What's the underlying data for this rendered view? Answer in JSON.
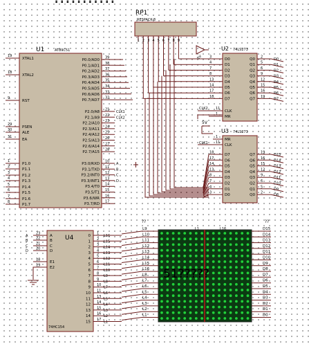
{
  "title": "???????????",
  "rp1": {
    "ref": "RP1",
    "part": "RESPACK-8",
    "pins": [
      "1",
      "2",
      "3",
      "4",
      "5",
      "6",
      "7",
      "8",
      "9"
    ]
  },
  "u1": {
    "ref": "U1",
    "part": "AT89C51",
    "left_pins": [
      {
        "num": "19",
        "name": "XTAL1"
      },
      {
        "num": "18",
        "name": "XTAL2"
      },
      {
        "num": "9",
        "name": "RST"
      },
      {
        "num": "29",
        "name": "PSEN"
      },
      {
        "num": "30",
        "name": "ALE"
      },
      {
        "num": "31",
        "name": "EA"
      },
      {
        "num": "1",
        "name": "P1.0"
      },
      {
        "num": "2",
        "name": "P1.1"
      },
      {
        "num": "3",
        "name": "P1.2"
      },
      {
        "num": "4",
        "name": "P1.3"
      },
      {
        "num": "5",
        "name": "P1.4"
      },
      {
        "num": "6",
        "name": "P1.5"
      },
      {
        "num": "7",
        "name": "P1.6"
      },
      {
        "num": "8",
        "name": "P1.7"
      }
    ],
    "p0": [
      {
        "name": "P0.0/AD0",
        "num": "39"
      },
      {
        "name": "P0.1/AD1",
        "num": "38"
      },
      {
        "name": "P0.2/AD2",
        "num": "37"
      },
      {
        "name": "P0.3/AD3",
        "num": "36"
      },
      {
        "name": "P0.4/AD4",
        "num": "35"
      },
      {
        "name": "P0.5/AD5",
        "num": "34"
      },
      {
        "name": "P0.6/AD6",
        "num": "33"
      },
      {
        "name": "P0.7/AD7",
        "num": "32"
      }
    ],
    "p2": [
      {
        "name": "P2.0/A8",
        "num": "21",
        "net": "CLK1"
      },
      {
        "name": "P2.1/A9",
        "num": "22",
        "net": "CLK2"
      },
      {
        "name": "P2.2/A10",
        "num": "23",
        "net": ""
      },
      {
        "name": "P2.3/A11",
        "num": "24",
        "net": ""
      },
      {
        "name": "P2.4/A12",
        "num": "25",
        "net": ""
      },
      {
        "name": "P2.5/A13",
        "num": "26",
        "net": ""
      },
      {
        "name": "P2.6/A14",
        "num": "27",
        "net": ""
      },
      {
        "name": "P2.7/A15",
        "num": "28",
        "net": ""
      }
    ],
    "p3": [
      {
        "name": "P3.0/RXD",
        "num": "10",
        "net": "A"
      },
      {
        "name": "P3.1/TXD",
        "num": "11",
        "net": "B"
      },
      {
        "name": "P3.2/INT0",
        "num": "12",
        "net": "C"
      },
      {
        "name": "P3.3/INT1",
        "num": "13",
        "net": "D"
      },
      {
        "name": "P3.4/T0",
        "num": "14",
        "net": ""
      },
      {
        "name": "P3.5/T1",
        "num": "15",
        "net": ""
      },
      {
        "name": "P3.6/WR",
        "num": "16",
        "net": ""
      },
      {
        "name": "P3.7/RD",
        "num": "17",
        "net": ""
      }
    ]
  },
  "u2": {
    "ref": "U2",
    "part": "74LS273",
    "inputs": [
      {
        "num": "3",
        "name": "D0"
      },
      {
        "num": "4",
        "name": "D1"
      },
      {
        "num": "7",
        "name": "D2"
      },
      {
        "num": "8",
        "name": "D3"
      },
      {
        "num": "13",
        "name": "D4"
      },
      {
        "num": "14",
        "name": "D5"
      },
      {
        "num": "17",
        "name": "D6"
      },
      {
        "num": "18",
        "name": "D7"
      }
    ],
    "outputs": [
      {
        "name": "Q0",
        "num": "2",
        "net": "D0"
      },
      {
        "name": "Q1",
        "num": "5",
        "net": "D1"
      },
      {
        "name": "Q2",
        "num": "6",
        "net": "D2"
      },
      {
        "name": "Q3",
        "num": "9",
        "net": "D3"
      },
      {
        "name": "Q4",
        "num": "12",
        "net": "D4"
      },
      {
        "name": "Q5",
        "num": "15",
        "net": "D5"
      },
      {
        "name": "Q6",
        "num": "16",
        "net": "D6"
      },
      {
        "name": "Q7",
        "num": "19",
        "net": "D7"
      }
    ],
    "clk_num": "11",
    "clk_name": "CLK",
    "clk_net": "CLK2",
    "mr_num": "1",
    "mr_name": "MR"
  },
  "u3": {
    "ref": "U3",
    "part": "74LS273",
    "mr_num": "1",
    "mr_name": "MR",
    "clk_num": "11",
    "clk_name": "CLK",
    "clk_net": "CLK1",
    "inputs": [
      {
        "num": "18",
        "name": "D7"
      },
      {
        "num": "17",
        "name": "D6"
      },
      {
        "num": "14",
        "name": "D5"
      },
      {
        "num": "13",
        "name": "D4"
      },
      {
        "num": "8",
        "name": "D3"
      },
      {
        "num": "7",
        "name": "D2"
      },
      {
        "num": "4",
        "name": "D1"
      },
      {
        "num": "3",
        "name": "D0"
      }
    ],
    "outputs": [
      {
        "name": "Q7",
        "num": "19",
        "net": "D15"
      },
      {
        "name": "Q6",
        "num": "16",
        "net": "D14"
      },
      {
        "name": "Q5",
        "num": "15",
        "net": "D13"
      },
      {
        "name": "Q4",
        "num": "12",
        "net": "D12"
      },
      {
        "name": "Q3",
        "num": "9",
        "net": "D11"
      },
      {
        "name": "Q2",
        "num": "6",
        "net": "D10"
      },
      {
        "name": "Q1",
        "num": "5",
        "net": "D9"
      },
      {
        "name": "Q0",
        "num": "2",
        "net": "D8"
      }
    ]
  },
  "u4": {
    "ref": "U4",
    "part": "74HC154",
    "inputs": [
      {
        "net": "A",
        "num": "23",
        "name": "A"
      },
      {
        "net": "B",
        "num": "22",
        "name": "B"
      },
      {
        "net": "C",
        "num": "21",
        "name": "C"
      },
      {
        "net": "D",
        "num": "20",
        "name": "D"
      },
      {
        "net": "",
        "num": "18",
        "name": "E1"
      },
      {
        "net": "",
        "num": "19",
        "name": "E2"
      }
    ],
    "outputs": [
      {
        "name": "0",
        "num": "1",
        "net": "L16"
      },
      {
        "name": "1",
        "num": "2",
        "net": "L15"
      },
      {
        "name": "2",
        "num": "3",
        "net": "L14"
      },
      {
        "name": "3",
        "num": "4",
        "net": "L13"
      },
      {
        "name": "4",
        "num": "5",
        "net": "L12"
      },
      {
        "name": "5",
        "num": "6",
        "net": "L11"
      },
      {
        "name": "6",
        "num": "7",
        "net": "L10"
      },
      {
        "name": "7",
        "num": "8",
        "net": "L9"
      },
      {
        "name": "8",
        "num": "9",
        "net": "L8"
      },
      {
        "name": "9",
        "num": "10",
        "net": "L7"
      },
      {
        "name": "10",
        "num": "11",
        "net": "L6"
      },
      {
        "name": "11",
        "num": "13",
        "net": "L5"
      },
      {
        "name": "12",
        "num": "14",
        "net": "L4"
      },
      {
        "name": "13",
        "num": "15",
        "net": "L3"
      },
      {
        "name": "14",
        "num": "16",
        "net": "L2"
      },
      {
        "name": "15",
        "num": "17",
        "net": "L1"
      }
    ]
  },
  "matrix": {
    "row_header": "??",
    "col_header": "??",
    "top_labels": [
      "L1",
      "L16"
    ],
    "left_labels": [
      "L9",
      "L10",
      "L11",
      "L12",
      "L13",
      "L14",
      "L15",
      "L16",
      "L8",
      "L7",
      "L6",
      "L5",
      "L4",
      "L3",
      "L2",
      "L1"
    ],
    "right_labels": [
      "D15",
      "D14",
      "D13",
      "D12",
      "D11",
      "D10",
      "D9",
      "D8",
      "D7",
      "D6",
      "D5",
      "D4",
      "D3",
      "D2",
      "D1",
      "D0"
    ],
    "watermark": "51?????",
    "led_color": "#21d13a",
    "panel_color": "#0b3a12",
    "watermark_color": "#e0241b"
  },
  "misc": {
    "vcc1": "5V",
    "vcc2": "5V"
  }
}
